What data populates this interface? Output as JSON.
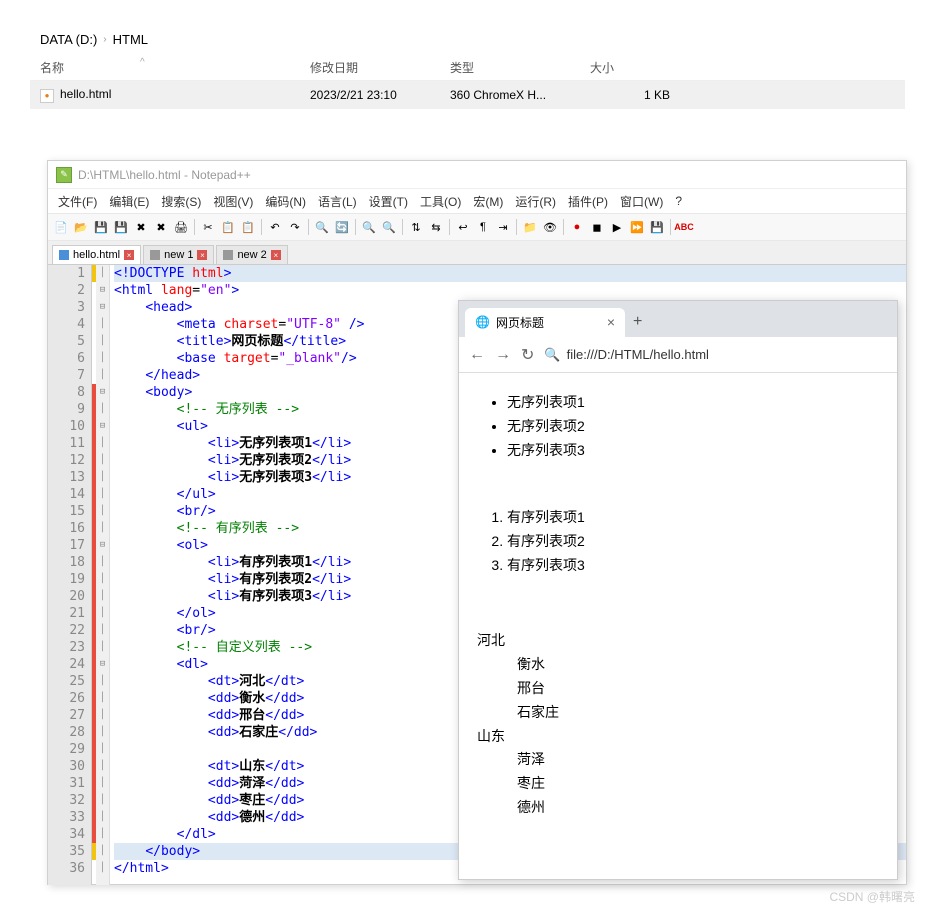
{
  "explorer": {
    "breadcrumb": [
      "DATA (D:)",
      "HTML"
    ],
    "columns": {
      "name": "名称",
      "date": "修改日期",
      "type": "类型",
      "size": "大小"
    },
    "file": {
      "name": "hello.html",
      "date": "2023/2/21 23:10",
      "type": "360 ChromeX H...",
      "size": "1 KB"
    }
  },
  "npp": {
    "title": "D:\\HTML\\hello.html - Notepad++",
    "menu": [
      "文件(F)",
      "编辑(E)",
      "搜索(S)",
      "视图(V)",
      "编码(N)",
      "语言(L)",
      "设置(T)",
      "工具(O)",
      "宏(M)",
      "运行(R)",
      "插件(P)",
      "窗口(W)",
      "?"
    ],
    "tabs": [
      {
        "label": "hello.html",
        "saved": true,
        "active": true
      },
      {
        "label": "new 1",
        "saved": false,
        "active": false
      },
      {
        "label": "new 2",
        "saved": false,
        "active": false
      }
    ],
    "lines": [
      {
        "n": 1,
        "fold": "",
        "chg": "yellow",
        "html": "<span class='hl-line'><span class='tag'>&lt;!DOCTYPE</span> <span class='attr'>html</span><span class='tag'>&gt;</span></span>"
      },
      {
        "n": 2,
        "fold": "⊟",
        "chg": "",
        "html": "<span class='tag'>&lt;html</span> <span class='attr'>lang</span>=<span class='val'>\"en\"</span><span class='tag'>&gt;</span>"
      },
      {
        "n": 3,
        "fold": "⊟",
        "chg": "",
        "html": "    <span class='tag'>&lt;head&gt;</span>"
      },
      {
        "n": 4,
        "fold": "",
        "chg": "",
        "html": "        <span class='tag'>&lt;meta</span> <span class='attr'>charset</span>=<span class='val'>\"UTF-8\"</span> <span class='tag'>/&gt;</span>"
      },
      {
        "n": 5,
        "fold": "",
        "chg": "",
        "html": "        <span class='tag'>&lt;title&gt;</span><span class='txt'>网页标题</span><span class='tag'>&lt;/title&gt;</span>"
      },
      {
        "n": 6,
        "fold": "",
        "chg": "",
        "html": "        <span class='tag'>&lt;base</span> <span class='attr'>target</span>=<span class='val'>\"_blank\"</span><span class='tag'>/&gt;</span>"
      },
      {
        "n": 7,
        "fold": "",
        "chg": "",
        "html": "    <span class='tag'>&lt;/head&gt;</span>"
      },
      {
        "n": 8,
        "fold": "⊟",
        "chg": "red",
        "html": "    <span class='tag'>&lt;body&gt;</span>"
      },
      {
        "n": 9,
        "fold": "",
        "chg": "red",
        "html": "        <span class='cmt'>&lt;!-- 无序列表 --&gt;</span>"
      },
      {
        "n": 10,
        "fold": "⊟",
        "chg": "red",
        "html": "        <span class='tag'>&lt;ul&gt;</span>"
      },
      {
        "n": 11,
        "fold": "",
        "chg": "red",
        "html": "            <span class='tag'>&lt;li&gt;</span><span class='txt'>无序列表项1</span><span class='tag'>&lt;/li&gt;</span>"
      },
      {
        "n": 12,
        "fold": "",
        "chg": "red",
        "html": "            <span class='tag'>&lt;li&gt;</span><span class='txt'>无序列表项2</span><span class='tag'>&lt;/li&gt;</span>"
      },
      {
        "n": 13,
        "fold": "",
        "chg": "red",
        "html": "            <span class='tag'>&lt;li&gt;</span><span class='txt'>无序列表项3</span><span class='tag'>&lt;/li&gt;</span>"
      },
      {
        "n": 14,
        "fold": "",
        "chg": "red",
        "html": "        <span class='tag'>&lt;/ul&gt;</span>"
      },
      {
        "n": 15,
        "fold": "",
        "chg": "red",
        "html": "        <span class='tag'>&lt;br/&gt;</span>"
      },
      {
        "n": 16,
        "fold": "",
        "chg": "red",
        "html": "        <span class='cmt'>&lt;!-- 有序列表 --&gt;</span>"
      },
      {
        "n": 17,
        "fold": "⊟",
        "chg": "red",
        "html": "        <span class='tag'>&lt;ol&gt;</span>"
      },
      {
        "n": 18,
        "fold": "",
        "chg": "red",
        "html": "            <span class='tag'>&lt;li&gt;</span><span class='txt'>有序列表项1</span><span class='tag'>&lt;/li&gt;</span>"
      },
      {
        "n": 19,
        "fold": "",
        "chg": "red",
        "html": "            <span class='tag'>&lt;li&gt;</span><span class='txt'>有序列表项2</span><span class='tag'>&lt;/li&gt;</span>"
      },
      {
        "n": 20,
        "fold": "",
        "chg": "red",
        "html": "            <span class='tag'>&lt;li&gt;</span><span class='txt'>有序列表项3</span><span class='tag'>&lt;/li&gt;</span>"
      },
      {
        "n": 21,
        "fold": "",
        "chg": "red",
        "html": "        <span class='tag'>&lt;/ol&gt;</span>"
      },
      {
        "n": 22,
        "fold": "",
        "chg": "red",
        "html": "        <span class='tag'>&lt;br/&gt;</span>"
      },
      {
        "n": 23,
        "fold": "",
        "chg": "red",
        "html": "        <span class='cmt'>&lt;!-- 自定义列表 --&gt;</span>"
      },
      {
        "n": 24,
        "fold": "⊟",
        "chg": "red",
        "html": "        <span class='tag'>&lt;dl&gt;</span>"
      },
      {
        "n": 25,
        "fold": "",
        "chg": "red",
        "html": "            <span class='tag'>&lt;dt&gt;</span><span class='txt'>河北</span><span class='tag'>&lt;/dt&gt;</span>"
      },
      {
        "n": 26,
        "fold": "",
        "chg": "red",
        "html": "            <span class='tag'>&lt;dd&gt;</span><span class='txt'>衡水</span><span class='tag'>&lt;/dd&gt;</span>"
      },
      {
        "n": 27,
        "fold": "",
        "chg": "red",
        "html": "            <span class='tag'>&lt;dd&gt;</span><span class='txt'>邢台</span><span class='tag'>&lt;/dd&gt;</span>"
      },
      {
        "n": 28,
        "fold": "",
        "chg": "red",
        "html": "            <span class='tag'>&lt;dd&gt;</span><span class='txt'>石家庄</span><span class='tag'>&lt;/dd&gt;</span>"
      },
      {
        "n": 29,
        "fold": "",
        "chg": "red",
        "html": ""
      },
      {
        "n": 30,
        "fold": "",
        "chg": "red",
        "html": "            <span class='tag'>&lt;dt&gt;</span><span class='txt'>山东</span><span class='tag'>&lt;/dt&gt;</span>"
      },
      {
        "n": 31,
        "fold": "",
        "chg": "red",
        "html": "            <span class='tag'>&lt;dd&gt;</span><span class='txt'>菏泽</span><span class='tag'>&lt;/dd&gt;</span>"
      },
      {
        "n": 32,
        "fold": "",
        "chg": "red",
        "html": "            <span class='tag'>&lt;dd&gt;</span><span class='txt'>枣庄</span><span class='tag'>&lt;/dd&gt;</span>"
      },
      {
        "n": 33,
        "fold": "",
        "chg": "red",
        "html": "            <span class='tag'>&lt;dd&gt;</span><span class='txt'>德州</span><span class='tag'>&lt;/dd&gt;</span>"
      },
      {
        "n": 34,
        "fold": "",
        "chg": "red",
        "html": "        <span class='tag'>&lt;/dl&gt;</span>"
      },
      {
        "n": 35,
        "fold": "",
        "chg": "yellow",
        "html": "<span class='hl-line'>    <span class='tag'>&lt;/body&gt;</span></span>"
      },
      {
        "n": 36,
        "fold": "",
        "chg": "",
        "html": "<span class='tag'>&lt;/html&gt;</span>"
      }
    ]
  },
  "browser": {
    "tab_title": "网页标题",
    "url": "file:///D:/HTML/hello.html",
    "ul": [
      "无序列表项1",
      "无序列表项2",
      "无序列表项3"
    ],
    "ol": [
      "有序列表项1",
      "有序列表项2",
      "有序列表项3"
    ],
    "dl": [
      {
        "dt": "河北",
        "dd": [
          "衡水",
          "邢台",
          "石家庄"
        ]
      },
      {
        "dt": "山东",
        "dd": [
          "菏泽",
          "枣庄",
          "德州"
        ]
      }
    ]
  },
  "watermark": "CSDN @韩曙亮"
}
